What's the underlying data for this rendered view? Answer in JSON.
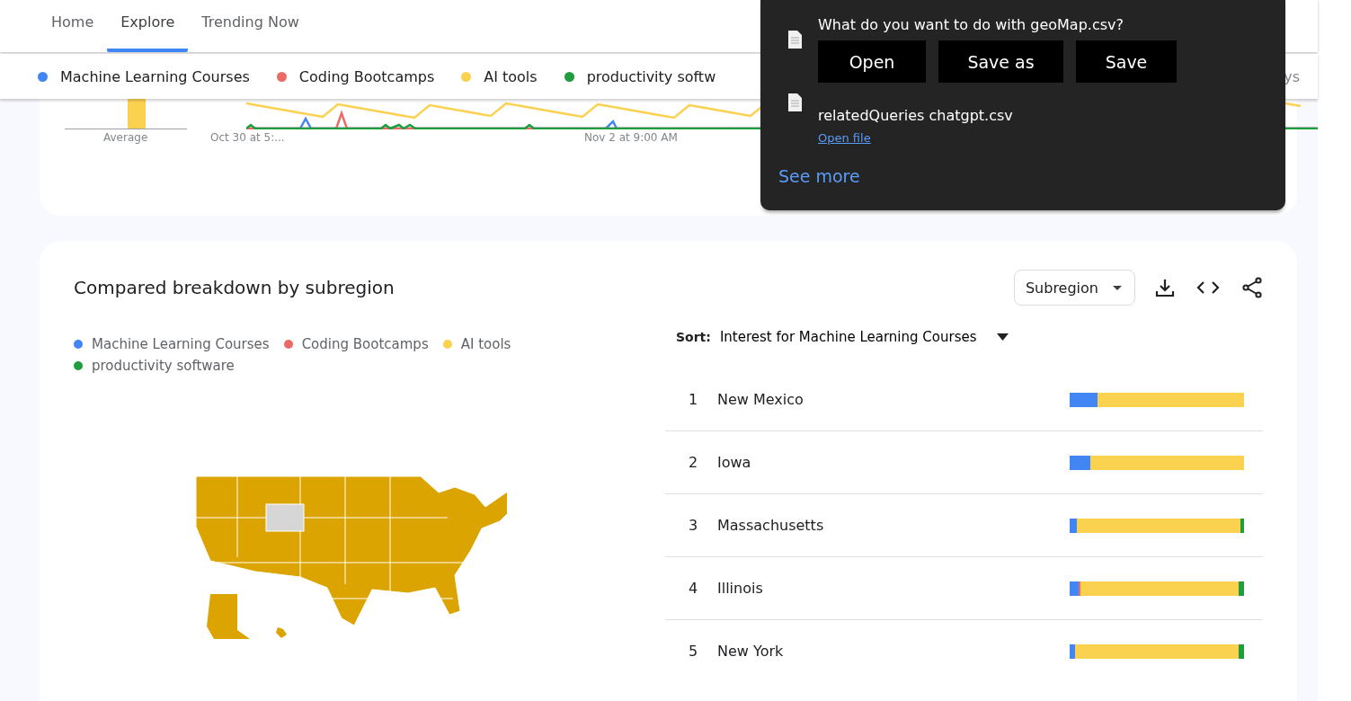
{
  "nav": {
    "tabs": [
      {
        "label": "Home",
        "selected": false
      },
      {
        "label": "Explore",
        "selected": true
      },
      {
        "label": "Trending Now",
        "selected": false
      }
    ]
  },
  "terms_bar": {
    "terms": [
      {
        "label": "Machine Learning Courses",
        "color": "#4285f4"
      },
      {
        "label": "Coding Bootcamps",
        "color": "#ea6b66"
      },
      {
        "label": "AI tools",
        "color": "#fbd150"
      },
      {
        "label": "productivity softw",
        "color": "#1e9e3e"
      }
    ],
    "trailing": "ys"
  },
  "timeline": {
    "average_label": "Average",
    "x_labels": [
      "Oct 30 at 5:...",
      "Nov 2 at 9:00 AM"
    ]
  },
  "download_popup": {
    "prompt": "What do you want to do with geoMap.csv?",
    "buttons": [
      "Open",
      "Save as",
      "Save"
    ],
    "recent_file": "relatedQueries chatgpt.csv",
    "open_link": "Open file",
    "see_more": "See more"
  },
  "subregion_card": {
    "title": "Compared breakdown by subregion",
    "dropdown": "Subregion",
    "legend": [
      {
        "label": "Machine Learning Courses",
        "color": "#4285f4"
      },
      {
        "label": "Coding Bootcamps",
        "color": "#ea6b66"
      },
      {
        "label": "AI tools",
        "color": "#fbd150"
      },
      {
        "label": "productivity software",
        "color": "#1e9e3e"
      }
    ],
    "sort_label": "Sort:",
    "sort_value": "Interest for Machine Learning Courses",
    "rows": [
      {
        "rank": "1",
        "name": "New Mexico",
        "segments": [
          {
            "color": "#4285f4",
            "level": 0.16
          },
          {
            "color": "#fbd150",
            "level": 0.84
          }
        ]
      },
      {
        "rank": "2",
        "name": "Iowa",
        "segments": [
          {
            "color": "#4285f4",
            "level": 0.12
          },
          {
            "color": "#fbd150",
            "level": 0.88
          }
        ]
      },
      {
        "rank": "3",
        "name": "Massachusetts",
        "segments": [
          {
            "color": "#4285f4",
            "level": 0.04
          },
          {
            "color": "#fbd150",
            "level": 0.94
          },
          {
            "color": "#1e9e3e",
            "level": 0.02
          }
        ]
      },
      {
        "rank": "4",
        "name": "Illinois",
        "segments": [
          {
            "color": "#4285f4",
            "level": 0.05
          },
          {
            "color": "#ea6b66",
            "level": 0.01
          },
          {
            "color": "#fbd150",
            "level": 0.91
          },
          {
            "color": "#1e9e3e",
            "level": 0.03
          }
        ]
      },
      {
        "rank": "5",
        "name": "New York",
        "segments": [
          {
            "color": "#4285f4",
            "level": 0.03
          },
          {
            "color": "#fbd150",
            "level": 0.94
          },
          {
            "color": "#1e9e3e",
            "level": 0.03
          }
        ]
      }
    ]
  }
}
